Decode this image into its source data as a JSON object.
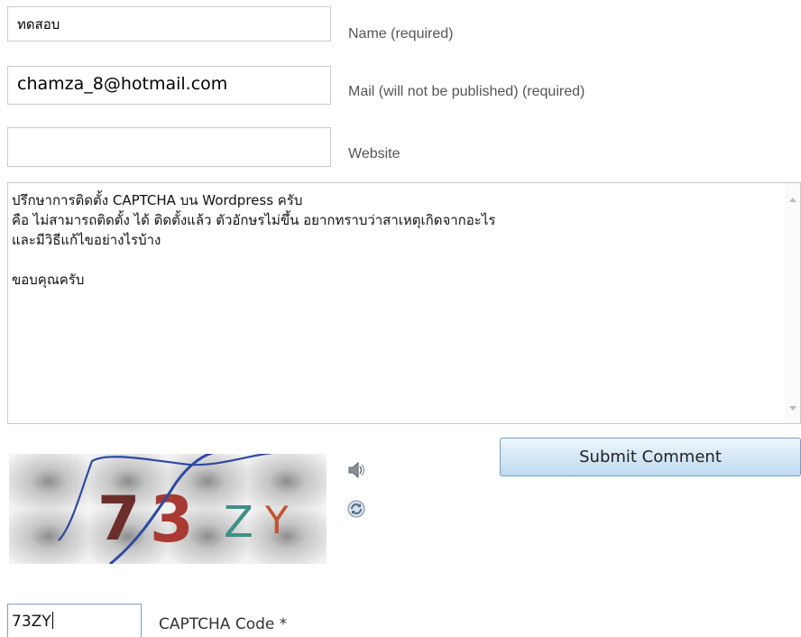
{
  "form": {
    "name": {
      "value": "ทดสอบ",
      "label": "Name (required)"
    },
    "email": {
      "value": "chamza_8@hotmail.com",
      "label": "Mail (will not be published) (required)"
    },
    "website": {
      "value": "",
      "label": "Website"
    },
    "comment": {
      "lines": [
        "ปรึกษาการติดตั้ง  CAPTCHA บน  Wordpress ครับ",
        "คือ  ไม่สามารถติดตั้ง  ได้  ติดตั้งแล้ว  ตัวอักษรไม่ขึ้น  อยากทราบว่าสาเหตุเกิดจากอะไร",
        "และมีวิธีแก้ไขอย่างไรบ้าง",
        "",
        "ขอบคุณครับ"
      ]
    },
    "submit_label": "Submit Comment",
    "captcha": {
      "image_glyphs": [
        "7",
        "3",
        "Z",
        "Y"
      ],
      "image_glyph_colors": [
        "#6b2e2a",
        "#a83a33",
        "#3f8f8a",
        "#c0552f"
      ],
      "audio_icon": "speaker-icon",
      "refresh_icon": "refresh-icon",
      "code_value": "73ZY",
      "code_label": "CAPTCHA Code *"
    }
  }
}
